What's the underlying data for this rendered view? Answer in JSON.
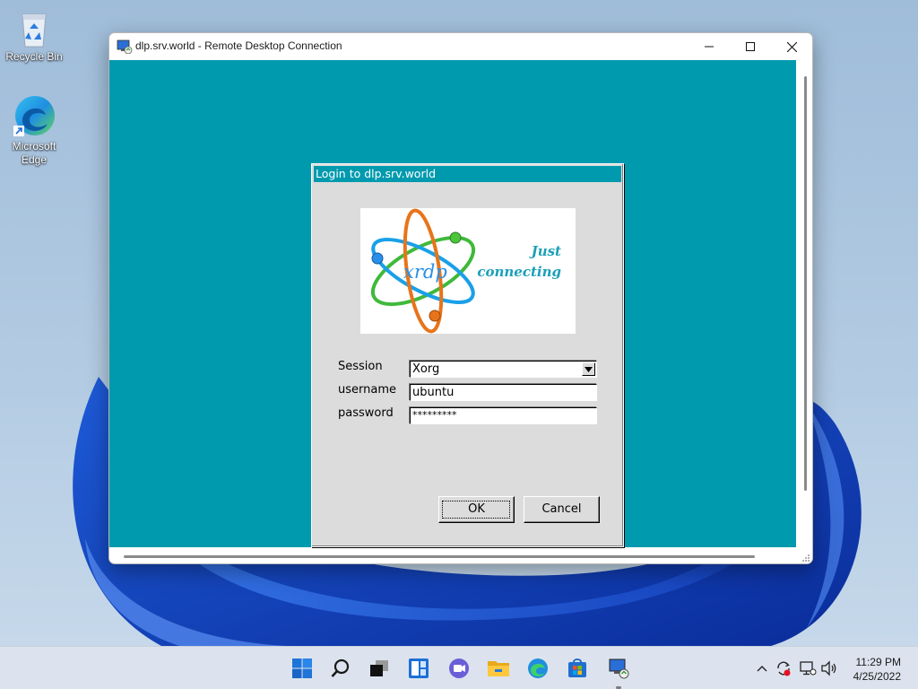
{
  "desktop": {
    "icons": [
      {
        "label": "Recycle Bin",
        "icon": "recycle-bin-icon"
      },
      {
        "label": "Microsoft Edge",
        "icon": "edge-icon"
      }
    ]
  },
  "rdp_window": {
    "title": "dlp.srv.world - Remote Desktop Connection",
    "icon": "remote-desktop-icon",
    "controls": [
      "minimize-icon",
      "maximize-icon",
      "close-icon"
    ],
    "remote_background": "#009aae"
  },
  "login_dialog": {
    "title": "Login to dlp.srv.world",
    "logo": {
      "name": "xrdp",
      "tagline_line1": "Just",
      "tagline_line2": "connecting"
    },
    "session": {
      "label": "Session",
      "value": "Xorg"
    },
    "username": {
      "label": "username",
      "value": "ubuntu"
    },
    "password": {
      "label": "password",
      "value": "*********"
    },
    "ok_label": "OK",
    "cancel_label": "Cancel"
  },
  "taskbar": {
    "apps": [
      "start-icon",
      "search-icon",
      "task-view-icon",
      "widgets-icon",
      "chat-icon",
      "file-explorer-icon",
      "edge-icon",
      "store-icon",
      "remote-desktop-icon"
    ],
    "tray": [
      "chevron-up-icon",
      "sync-icon",
      "network-icon",
      "volume-icon"
    ],
    "time": "11:29 PM",
    "date": "4/25/2022"
  },
  "colors": {
    "accent": "#009aae",
    "dialog_bg": "#dcdcdc",
    "taskbar_bg": "#dce3ee"
  }
}
